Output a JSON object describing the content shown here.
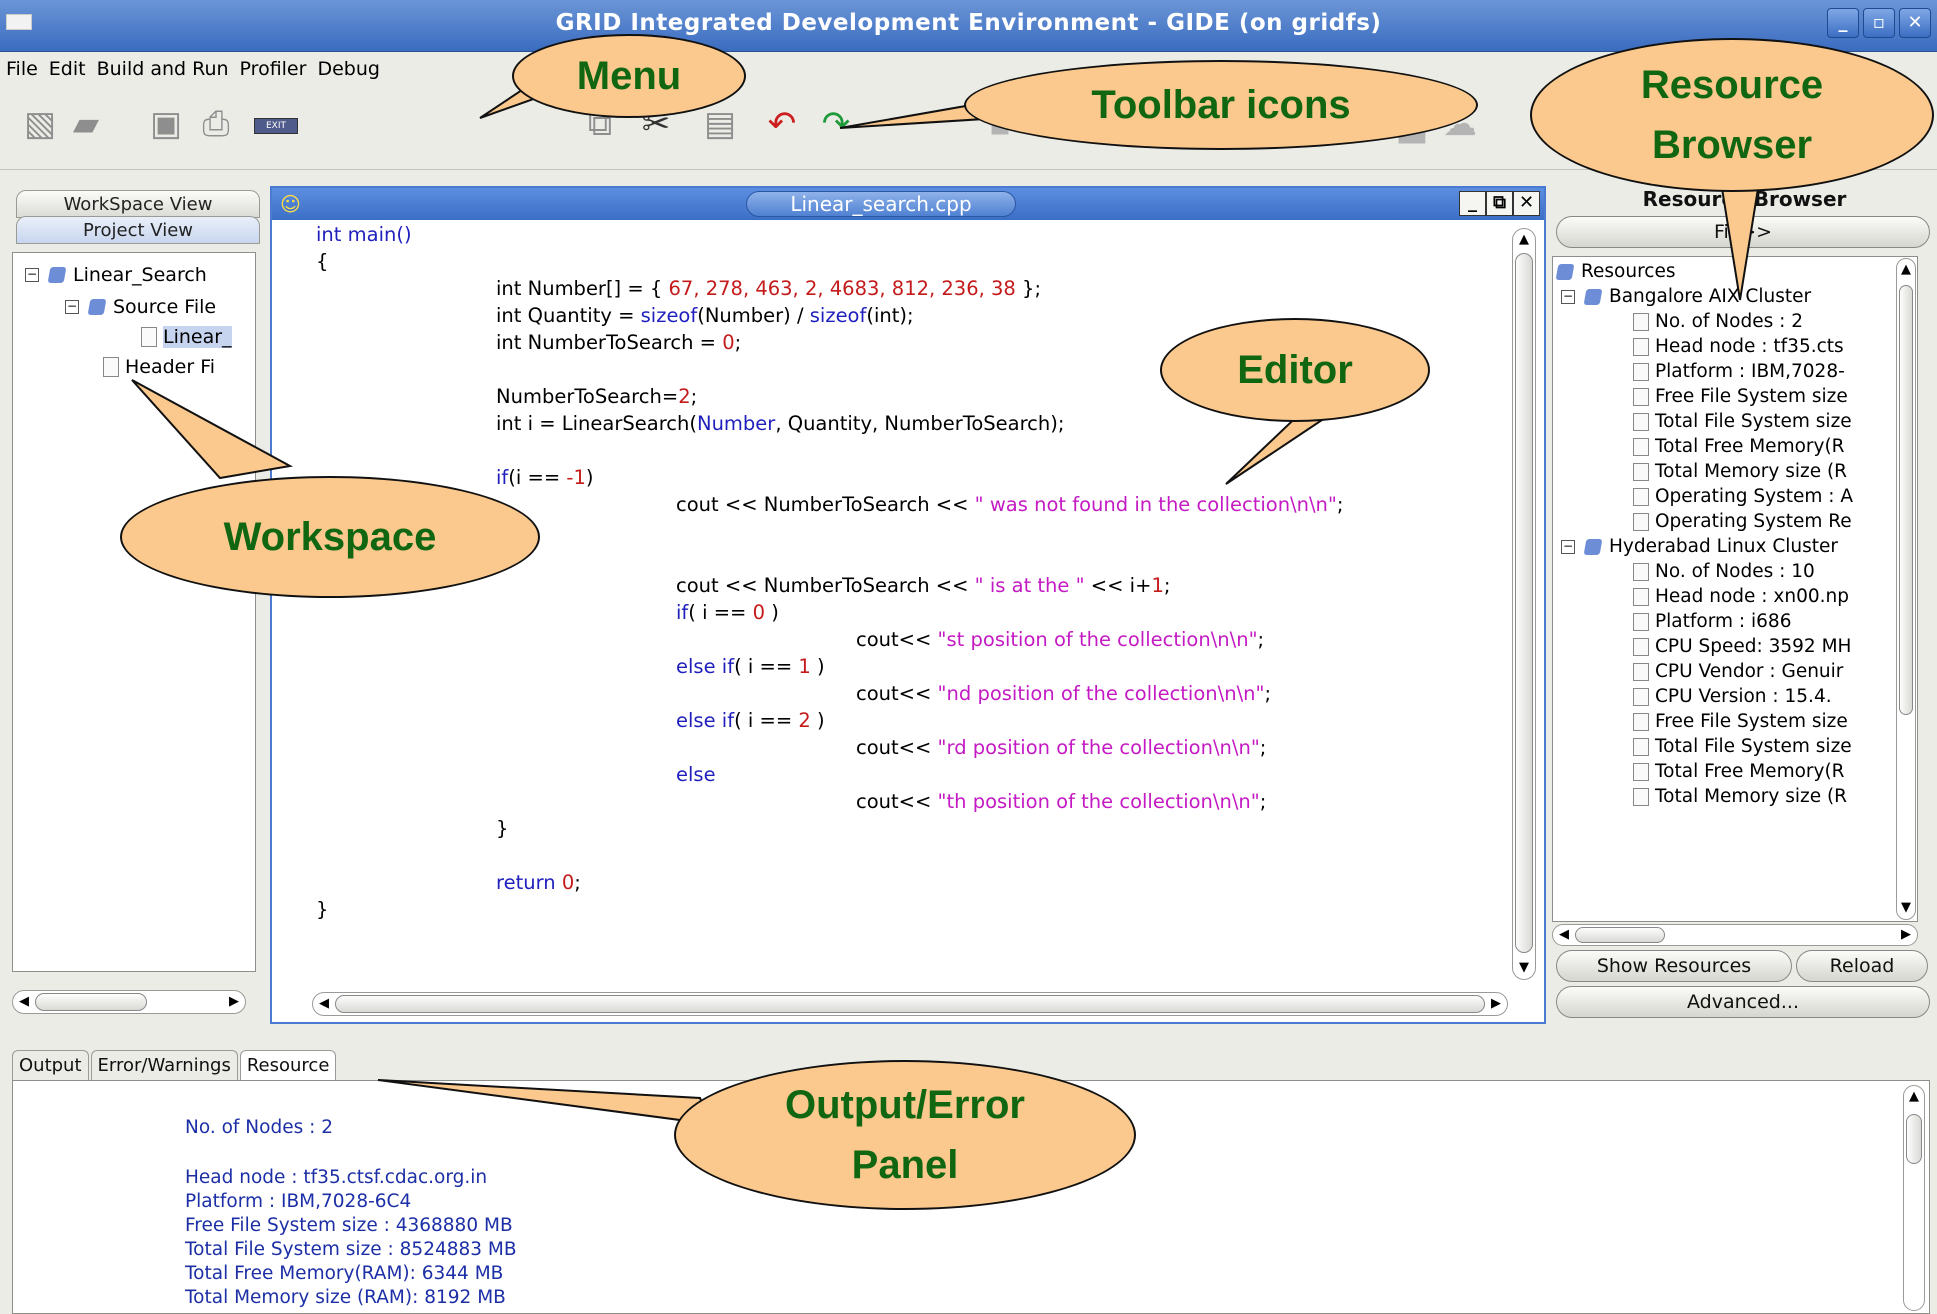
{
  "window": {
    "title": "GRID Integrated Development Environment - GIDE (on gridfs)",
    "buttons": [
      "_",
      "▫",
      "✕"
    ]
  },
  "menu": [
    {
      "label": "File"
    },
    {
      "label": "Edit"
    },
    {
      "label": "Build and Run"
    },
    {
      "label": "Profiler"
    },
    {
      "label": "Debug"
    }
  ],
  "workspace": {
    "tabs": [
      "WorkSpace View",
      "Project View"
    ],
    "tree": [
      {
        "label": "Linear_Search",
        "expand": "−"
      },
      {
        "label": "Source File",
        "expand": "−"
      },
      {
        "label": "Linear_"
      },
      {
        "label": "Header Fi"
      }
    ]
  },
  "editor": {
    "tab": "Linear_search.cpp",
    "lines": {
      "l1": "int main()",
      "l2": "{",
      "l3a": "int Number[] = { ",
      "l3b": "67, 278, 463, 2, 4683, 812, 236, 38",
      "l3c": " };",
      "l4a": "int Quantity = ",
      "l4b": "sizeof",
      "l4c": "(Number) / ",
      "l4d": "sizeof",
      "l4e": "(int);",
      "l5a": "int NumberToSearch = ",
      "l5b": "0",
      "l5c": ";",
      "l6a": "NumberToSearch=",
      "l6b": "2",
      "l6c": ";",
      "l7a": "int i = LinearSearch(",
      "l7b": "Number",
      "l7c": ", Quantity, NumberToSearch);",
      "l8a": "if",
      "l8b": "(i == ",
      "l8c": "-1",
      "l8d": ")",
      "l9a": "cout << NumberToSearch << ",
      "l9b": "\" was not found in the collection\\n\\n\"",
      "l9c": ";",
      "l10": "else",
      "l11": "{",
      "l12a": "cout << NumberToSearch << ",
      "l12b": "\" is at the \"",
      "l12c": " << i+",
      "l12d": "1",
      "l12e": ";",
      "l13a": "if",
      "l13b": "( i == ",
      "l13c": "0",
      "l13d": " )",
      "l14a": "cout<< ",
      "l14b": "\"st position of the collection\\n\\n\"",
      "l14c": ";",
      "l15a": "else if",
      "l15b": "( i == ",
      "l15c": "1",
      "l15d": " )",
      "l16a": "cout<< ",
      "l16b": "\"nd position of the collection\\n\\n\"",
      "l16c": ";",
      "l17a": "else if",
      "l17b": "( i == ",
      "l17c": "2",
      "l17d": " )",
      "l18a": "cout<< ",
      "l18b": "\"rd position of the collection\\n\\n\"",
      "l18c": ";",
      "l19": "else",
      "l20a": "cout<< ",
      "l20b": "\"th position of the collection\\n\\n\"",
      "l20c": ";",
      "l21": "}",
      "l22a": "return ",
      "l22b": "0",
      "l22c": ";",
      "l23": "}"
    }
  },
  "resource_browser": {
    "title": "Resource Browser",
    "top_button": "Fil >>",
    "tree": {
      "root": "Resources",
      "c1": "Bangalore AIX Cluster",
      "c1_items": [
        "No. of Nodes : 2",
        "Head node : tf35.cts",
        "Platform : IBM,7028-",
        "Free File System size",
        "Total File System size",
        "Total Free Memory(R",
        "Total Memory size (R",
        "Operating System :  A",
        "Operating  System Re"
      ],
      "c2": "Hyderabad Linux Cluster",
      "c2_items": [
        "No. of Nodes : 10",
        "Head node : xn00.np",
        "Platform : i686",
        "CPU Speed: 3592 MH",
        "CPU Vendor :  Genuir",
        "CPU Version :  15.4.",
        "Free File System size",
        "Total File System size",
        "Total Free Memory(R",
        "Total Memory size (R"
      ]
    },
    "show_resources": "Show Resources",
    "reload": "Reload",
    "advanced": "Advanced..."
  },
  "bottom": {
    "tabs": [
      "Output",
      "Error/Warnings",
      "Resource"
    ],
    "lines": [
      "No. of Nodes : 2",
      "Head node : tf35.ctsf.cdac.org.in",
      "Platform : IBM,7028-6C4",
      "Free File System size :  4368880 MB",
      "Total File System size :  8524883 MB",
      "Total Free Memory(RAM):  6344 MB",
      "Total Memory size (RAM):  8192 MB"
    ]
  },
  "callouts": {
    "menu": "Menu",
    "toolbar": "Toolbar icons",
    "resource_browser": [
      "Resource",
      "Browser"
    ],
    "editor": "Editor",
    "workspace": "Workspace",
    "output": [
      "Output/Error",
      "Panel"
    ]
  },
  "colors": {
    "keyword": "#1f1fbd",
    "number": "#c41a1a",
    "string": "#c41ac4",
    "callout_fill": "#fbc98e",
    "callout_text": "#116611",
    "title_bar": "#3a6cc0",
    "output_text": "#1c2fa6"
  },
  "icons": [
    "new-file-icon",
    "open-folder-icon",
    "save-icon",
    "print-icon",
    "exit-icon",
    "copy-icon",
    "cut-icon",
    "paste-icon",
    "undo-icon",
    "redo-icon",
    "build-icon",
    "run-icon",
    "cluster-icon",
    "cloud-icon"
  ]
}
